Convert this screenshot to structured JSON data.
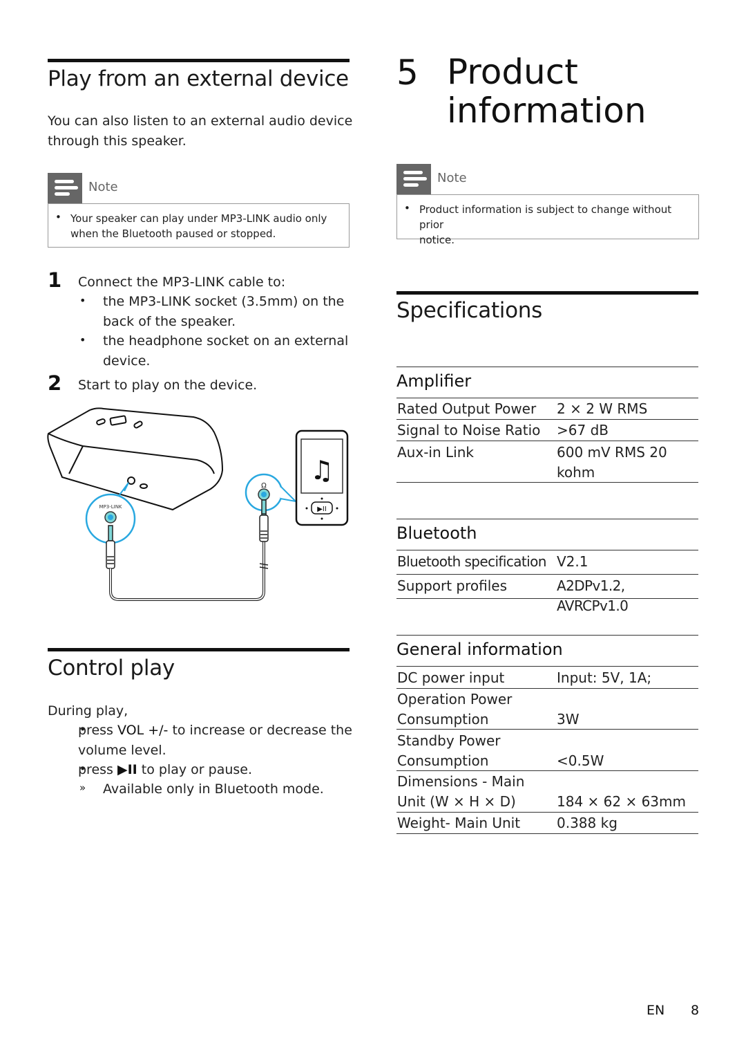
{
  "left": {
    "play_external": {
      "title": "Play from an external device",
      "intro": [
        "You can also listen to an external audio device",
        "through this speaker."
      ],
      "note": {
        "label": "Note",
        "bullet": "•",
        "lines": [
          "Your speaker can play under MP3-LINK audio only",
          "when the Bluetooth paused or stopped."
        ]
      },
      "steps": [
        {
          "number": "1",
          "text": "Connect the MP3-LINK cable to:",
          "bullets": [
            {
              "lines": [
                "the MP3-LINK socket (3.5mm) on the",
                "back of the speaker."
              ]
            },
            {
              "lines": [
                "the headphone socket on an external",
                "device."
              ]
            }
          ]
        },
        {
          "number": "2",
          "text": "Start to play on the device.",
          "bullets": []
        }
      ],
      "illustration": {
        "jack_label": "MP3-LINK",
        "headphone_symbol": "Ω",
        "player_button": "▶II",
        "accent_color": "#29a8e0",
        "socket_color": "#7fd6d6"
      }
    },
    "control_play": {
      "title": "Control play",
      "intro": "During play,",
      "bullets": [
        {
          "prefix": "press ",
          "emph": "VOL +/-",
          "suffix": " to increase or decrease the",
          "line2": "volume level."
        },
        {
          "prefix": "press ",
          "emph": "▶II",
          "suffix": " to play or pause.",
          "line2": ""
        }
      ],
      "sub_bullet_marker": "»",
      "sub_bullet": "Available only in Bluetooth mode."
    }
  },
  "right": {
    "chapter": {
      "number": "5",
      "title_line1": "Product",
      "title_line2": "information"
    },
    "note": {
      "label": "Note",
      "bullet": "•",
      "lines": [
        "Product information is subject to change without prior",
        "notice."
      ]
    },
    "specifications": {
      "title": "Specifications",
      "groups": [
        {
          "name": "Amplifier",
          "rows": [
            {
              "label": "Rated Output Power",
              "value": "2 × 2 W RMS"
            },
            {
              "label": "Signal to Noise Ratio",
              "value": ">67 dB"
            },
            {
              "label": "Aux-in Link",
              "value": "600 mV RMS 20",
              "value2": "kohm"
            }
          ]
        },
        {
          "name": "Bluetooth",
          "rows": [
            {
              "label": "Bluetooth specification",
              "value": "V2.1"
            },
            {
              "label": "Support profiles",
              "value": "A2DPv1.2, AVRCPv1.0"
            }
          ]
        },
        {
          "name": "General information",
          "rows": [
            {
              "label": "DC power input",
              "value": "Input: 5V, 1A;"
            },
            {
              "label": "Operation Power",
              "label2": "Consumption",
              "value": "3W"
            },
            {
              "label": "Standby Power",
              "label2": "Consumption",
              "value": "<0.5W"
            },
            {
              "label": "Dimensions - Main",
              "label2": "Unit (W × H × D)",
              "value": "184 × 62 × 63mm"
            },
            {
              "label": "Weight- Main Unit",
              "value": "0.388 kg"
            }
          ]
        }
      ]
    }
  },
  "footer": {
    "language": "EN",
    "page_number": "8"
  }
}
